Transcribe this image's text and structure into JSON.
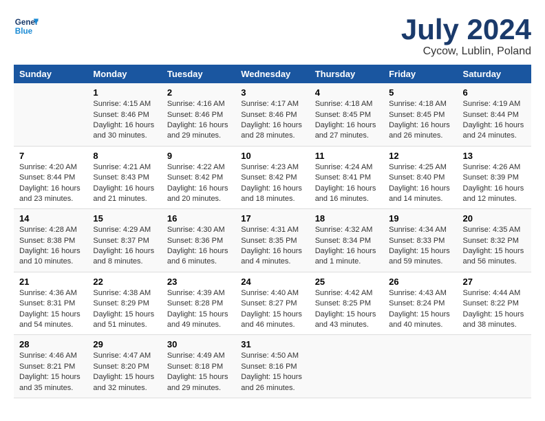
{
  "header": {
    "logo_line1": "General",
    "logo_line2": "Blue",
    "month": "July 2024",
    "location": "Cycow, Lublin, Poland"
  },
  "days_of_week": [
    "Sunday",
    "Monday",
    "Tuesday",
    "Wednesday",
    "Thursday",
    "Friday",
    "Saturday"
  ],
  "weeks": [
    [
      {
        "day": "",
        "info": ""
      },
      {
        "day": "1",
        "info": "Sunrise: 4:15 AM\nSunset: 8:46 PM\nDaylight: 16 hours\nand 30 minutes."
      },
      {
        "day": "2",
        "info": "Sunrise: 4:16 AM\nSunset: 8:46 PM\nDaylight: 16 hours\nand 29 minutes."
      },
      {
        "day": "3",
        "info": "Sunrise: 4:17 AM\nSunset: 8:46 PM\nDaylight: 16 hours\nand 28 minutes."
      },
      {
        "day": "4",
        "info": "Sunrise: 4:18 AM\nSunset: 8:45 PM\nDaylight: 16 hours\nand 27 minutes."
      },
      {
        "day": "5",
        "info": "Sunrise: 4:18 AM\nSunset: 8:45 PM\nDaylight: 16 hours\nand 26 minutes."
      },
      {
        "day": "6",
        "info": "Sunrise: 4:19 AM\nSunset: 8:44 PM\nDaylight: 16 hours\nand 24 minutes."
      }
    ],
    [
      {
        "day": "7",
        "info": "Sunrise: 4:20 AM\nSunset: 8:44 PM\nDaylight: 16 hours\nand 23 minutes."
      },
      {
        "day": "8",
        "info": "Sunrise: 4:21 AM\nSunset: 8:43 PM\nDaylight: 16 hours\nand 21 minutes."
      },
      {
        "day": "9",
        "info": "Sunrise: 4:22 AM\nSunset: 8:42 PM\nDaylight: 16 hours\nand 20 minutes."
      },
      {
        "day": "10",
        "info": "Sunrise: 4:23 AM\nSunset: 8:42 PM\nDaylight: 16 hours\nand 18 minutes."
      },
      {
        "day": "11",
        "info": "Sunrise: 4:24 AM\nSunset: 8:41 PM\nDaylight: 16 hours\nand 16 minutes."
      },
      {
        "day": "12",
        "info": "Sunrise: 4:25 AM\nSunset: 8:40 PM\nDaylight: 16 hours\nand 14 minutes."
      },
      {
        "day": "13",
        "info": "Sunrise: 4:26 AM\nSunset: 8:39 PM\nDaylight: 16 hours\nand 12 minutes."
      }
    ],
    [
      {
        "day": "14",
        "info": "Sunrise: 4:28 AM\nSunset: 8:38 PM\nDaylight: 16 hours\nand 10 minutes."
      },
      {
        "day": "15",
        "info": "Sunrise: 4:29 AM\nSunset: 8:37 PM\nDaylight: 16 hours\nand 8 minutes."
      },
      {
        "day": "16",
        "info": "Sunrise: 4:30 AM\nSunset: 8:36 PM\nDaylight: 16 hours\nand 6 minutes."
      },
      {
        "day": "17",
        "info": "Sunrise: 4:31 AM\nSunset: 8:35 PM\nDaylight: 16 hours\nand 4 minutes."
      },
      {
        "day": "18",
        "info": "Sunrise: 4:32 AM\nSunset: 8:34 PM\nDaylight: 16 hours\nand 1 minute."
      },
      {
        "day": "19",
        "info": "Sunrise: 4:34 AM\nSunset: 8:33 PM\nDaylight: 15 hours\nand 59 minutes."
      },
      {
        "day": "20",
        "info": "Sunrise: 4:35 AM\nSunset: 8:32 PM\nDaylight: 15 hours\nand 56 minutes."
      }
    ],
    [
      {
        "day": "21",
        "info": "Sunrise: 4:36 AM\nSunset: 8:31 PM\nDaylight: 15 hours\nand 54 minutes."
      },
      {
        "day": "22",
        "info": "Sunrise: 4:38 AM\nSunset: 8:29 PM\nDaylight: 15 hours\nand 51 minutes."
      },
      {
        "day": "23",
        "info": "Sunrise: 4:39 AM\nSunset: 8:28 PM\nDaylight: 15 hours\nand 49 minutes."
      },
      {
        "day": "24",
        "info": "Sunrise: 4:40 AM\nSunset: 8:27 PM\nDaylight: 15 hours\nand 46 minutes."
      },
      {
        "day": "25",
        "info": "Sunrise: 4:42 AM\nSunset: 8:25 PM\nDaylight: 15 hours\nand 43 minutes."
      },
      {
        "day": "26",
        "info": "Sunrise: 4:43 AM\nSunset: 8:24 PM\nDaylight: 15 hours\nand 40 minutes."
      },
      {
        "day": "27",
        "info": "Sunrise: 4:44 AM\nSunset: 8:22 PM\nDaylight: 15 hours\nand 38 minutes."
      }
    ],
    [
      {
        "day": "28",
        "info": "Sunrise: 4:46 AM\nSunset: 8:21 PM\nDaylight: 15 hours\nand 35 minutes."
      },
      {
        "day": "29",
        "info": "Sunrise: 4:47 AM\nSunset: 8:20 PM\nDaylight: 15 hours\nand 32 minutes."
      },
      {
        "day": "30",
        "info": "Sunrise: 4:49 AM\nSunset: 8:18 PM\nDaylight: 15 hours\nand 29 minutes."
      },
      {
        "day": "31",
        "info": "Sunrise: 4:50 AM\nSunset: 8:16 PM\nDaylight: 15 hours\nand 26 minutes."
      },
      {
        "day": "",
        "info": ""
      },
      {
        "day": "",
        "info": ""
      },
      {
        "day": "",
        "info": ""
      }
    ]
  ]
}
